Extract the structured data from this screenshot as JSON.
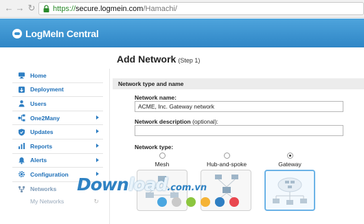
{
  "browser": {
    "url_scheme": "https://",
    "url_host": "secure.logmein.com",
    "url_path": "/Hamachi/"
  },
  "header": {
    "brand": "LogMeIn Central"
  },
  "page": {
    "title": "Add Network",
    "step": "(Step 1)"
  },
  "sidebar": {
    "items": [
      {
        "label": "Home",
        "icon": "monitor-icon",
        "arrow": false
      },
      {
        "label": "Deployment",
        "icon": "deploy-icon",
        "arrow": false
      },
      {
        "label": "Users",
        "icon": "user-icon",
        "arrow": false
      },
      {
        "label": "One2Many",
        "icon": "one2many-icon",
        "arrow": true
      },
      {
        "label": "Updates",
        "icon": "shield-icon",
        "arrow": true
      },
      {
        "label": "Reports",
        "icon": "bar-chart-icon",
        "arrow": true
      },
      {
        "label": "Alerts",
        "icon": "bell-icon",
        "arrow": true
      },
      {
        "label": "Configuration",
        "icon": "gear-icon",
        "arrow": true
      },
      {
        "label": "Networks",
        "icon": "network-icon",
        "arrow": false
      }
    ],
    "sub_item": "My Networks"
  },
  "form": {
    "section_title": "Network type and name",
    "name_label": "Network name:",
    "name_value": "ACME, Inc. Gateway network",
    "desc_label": "Network description",
    "desc_optional": "(optional):",
    "desc_value": "",
    "type_label": "Network type:",
    "types": [
      {
        "label": "Mesh",
        "selected": false
      },
      {
        "label": "Hub-and-spoke",
        "selected": false
      },
      {
        "label": "Gateway",
        "selected": true
      }
    ]
  },
  "watermark": {
    "part1": "Down",
    "part2": "load",
    "part3": ".com.vn",
    "dot_colors": [
      "#4aa6e0",
      "#c9c9c9",
      "#8cc63f",
      "#f5b335",
      "#2f7fc3",
      "#e9474f"
    ]
  },
  "colors": {
    "header_blue": "#3a92d0",
    "nav_blue": "#1d6fb8",
    "selected_border": "#6ab2e6"
  }
}
